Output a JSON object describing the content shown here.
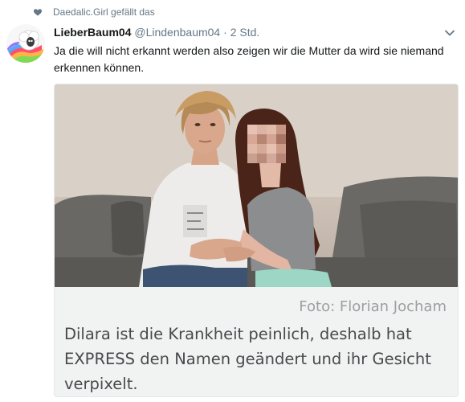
{
  "social_context": {
    "icon": "heart-icon",
    "text": "Daedalic.Girl gefällt das"
  },
  "tweet": {
    "avatar_icon": "rainbow-sheep-avatar",
    "display_name": "LieberBaum04",
    "handle": "@Lindenbaum04",
    "separator": " · ",
    "time": "2 Std.",
    "menu_icon": "chevron-down-icon",
    "text": "Ja die will nicht erkannt werden also zeigen wir die Mutter da wird sie niemand erkennen können."
  },
  "media": {
    "image_description_icon": "photo-mother-daughter-pixelated-face",
    "credit": "Foto: Florian Jocham",
    "caption": "Dilara ist die Krankheit peinlich, deshalb hat EXPRESS den Namen geändert und ihr Gesicht verpixelt."
  },
  "colors": {
    "muted": "#657786",
    "border": "#e1e8ed",
    "caption_bg": "#f1f3f2"
  }
}
